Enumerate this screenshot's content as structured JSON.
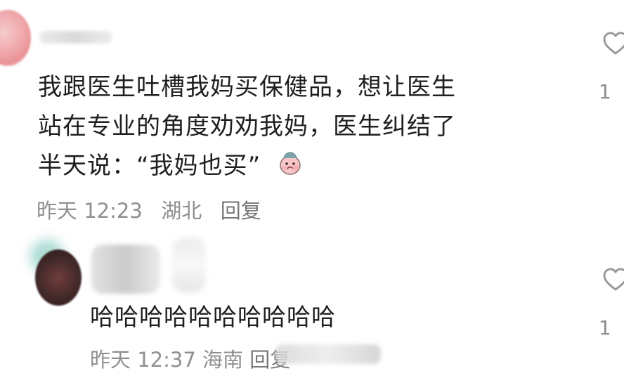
{
  "comment": {
    "text_lines": [
      "我跟医生吐槽我妈买保健品，想让医生",
      "站在专业的角度劝劝我妈，医生纠结了",
      "半天说：“我妈也买”"
    ],
    "meta": {
      "time": "昨天 12:23",
      "location": "湖北",
      "reply_label": "回复"
    },
    "like_count_visible": "1"
  },
  "reply": {
    "text": "哈哈哈哈哈哈哈哈哈哈",
    "meta": {
      "time": "昨天 12:37",
      "location": "海南",
      "reply_label": "回复"
    },
    "like_count_visible": "1"
  },
  "icons": {
    "heart": "heart-icon",
    "emoji": "sad-face-sticker-icon"
  },
  "colors": {
    "text_primary": "#1f1f1f",
    "text_secondary": "#8f8f8f",
    "icon_gray": "#9a9a9a"
  }
}
